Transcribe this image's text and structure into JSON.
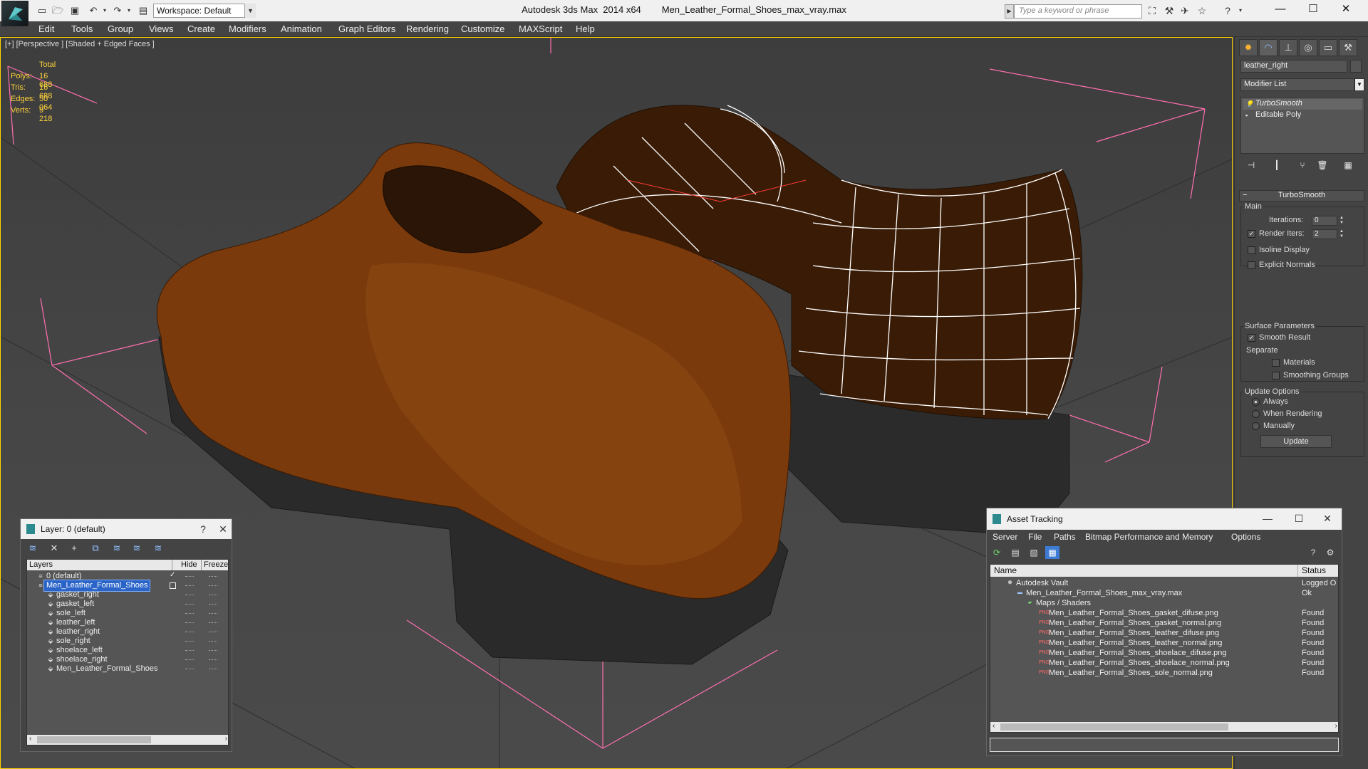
{
  "titlebar": {
    "app_name": "Autodesk 3ds Max  2014 x64",
    "file_name": "Men_Leather_Formal_Shoes_max_vray.max",
    "workspace": "Workspace: Default",
    "search_placeholder": "Type a keyword or phrase",
    "minimize": "—",
    "maximize": "☐",
    "close": "✕"
  },
  "menu": [
    "Edit",
    "Tools",
    "Group",
    "Views",
    "Create",
    "Modifiers",
    "Animation",
    "Graph Editors",
    "Rendering",
    "Customize",
    "MAXScript",
    "Help"
  ],
  "viewport": {
    "label": "[+] [Perspective ] [Shaded + Edged Faces ]",
    "stats": {
      "header": "Total",
      "rows": [
        {
          "name": "Polys:",
          "value": "16 688"
        },
        {
          "name": "Tris:",
          "value": "16 688"
        },
        {
          "name": "Edges:",
          "value": "50 064"
        },
        {
          "name": "Verts:",
          "value": "9 218"
        }
      ]
    }
  },
  "command_panel": {
    "object_name": "leather_right",
    "modifier_list": "Modifier List",
    "stack": [
      "TurboSmooth",
      "Editable Poly"
    ],
    "rollout_title": "TurboSmooth",
    "main_label": "Main",
    "iterations_label": "Iterations:",
    "iterations_value": "0",
    "render_iters_label": "Render Iters:",
    "render_iters_value": "2",
    "render_iters_checked": true,
    "isoline_label": "Isoline Display",
    "explicit_normals_label": "Explicit Normals",
    "surface_params_label": "Surface Parameters",
    "smooth_result_label": "Smooth Result",
    "smooth_result_checked": true,
    "separate_label": "Separate",
    "materials_label": "Materials",
    "smoothing_groups_label": "Smoothing Groups",
    "update_options_label": "Update Options",
    "always_label": "Always",
    "when_rendering_label": "When Rendering",
    "manually_label": "Manually",
    "update_button": "Update"
  },
  "layer_dialog": {
    "title": "Layer: 0 (default)",
    "help": "?",
    "close": "✕",
    "columns": [
      "Layers",
      "Hide",
      "Freeze"
    ],
    "layers": [
      {
        "name": "0 (default)",
        "level": 0,
        "selected": false,
        "current": true
      },
      {
        "name": "Men_Leather_Formal_Shoes",
        "level": 0,
        "selected": true,
        "current": false
      },
      {
        "name": "gasket_right",
        "level": 1,
        "selected": false,
        "current": false
      },
      {
        "name": "gasket_left",
        "level": 1,
        "selected": false,
        "current": false
      },
      {
        "name": "sole_left",
        "level": 1,
        "selected": false,
        "current": false
      },
      {
        "name": "leather_left",
        "level": 1,
        "selected": false,
        "current": false
      },
      {
        "name": "leather_right",
        "level": 1,
        "selected": false,
        "current": false
      },
      {
        "name": "sole_right",
        "level": 1,
        "selected": false,
        "current": false
      },
      {
        "name": "shoelace_left",
        "level": 1,
        "selected": false,
        "current": false
      },
      {
        "name": "shoelace_right",
        "level": 1,
        "selected": false,
        "current": false
      },
      {
        "name": "Men_Leather_Formal_Shoes",
        "level": 1,
        "selected": false,
        "current": false
      }
    ]
  },
  "asset_dialog": {
    "title": "Asset Tracking",
    "menu": [
      "Server",
      "File",
      "Paths",
      "Bitmap Performance and Memory",
      "Options"
    ],
    "columns": [
      "Name",
      "Status"
    ],
    "rows": [
      {
        "name": "Autodesk Vault",
        "status": "Logged O",
        "level": 0,
        "kind": "vault"
      },
      {
        "name": "Men_Leather_Formal_Shoes_max_vray.max",
        "status": "Ok",
        "level": 1,
        "kind": "max"
      },
      {
        "name": "Maps / Shaders",
        "status": "",
        "level": 2,
        "kind": "folder"
      },
      {
        "name": "Men_Leather_Formal_Shoes_gasket_difuse.png",
        "status": "Found",
        "level": 3,
        "kind": "png"
      },
      {
        "name": "Men_Leather_Formal_Shoes_gasket_normal.png",
        "status": "Found",
        "level": 3,
        "kind": "png"
      },
      {
        "name": "Men_Leather_Formal_Shoes_leather_difuse.png",
        "status": "Found",
        "level": 3,
        "kind": "png"
      },
      {
        "name": "Men_Leather_Formal_Shoes_leather_normal.png",
        "status": "Found",
        "level": 3,
        "kind": "png"
      },
      {
        "name": "Men_Leather_Formal_Shoes_shoelace_difuse.png",
        "status": "Found",
        "level": 3,
        "kind": "png"
      },
      {
        "name": "Men_Leather_Formal_Shoes_shoelace_normal.png",
        "status": "Found",
        "level": 3,
        "kind": "png"
      },
      {
        "name": "Men_Leather_Formal_Shoes_sole_normal.png",
        "status": "Found",
        "level": 3,
        "kind": "png"
      }
    ]
  },
  "colors": {
    "viewport_border": "#ffd400",
    "stats_text": "#ffd23a",
    "selection": "#2a64c8",
    "leather": "#7a3a0c",
    "sole": "#2a2a2a",
    "gizmo": "#ff6fb0"
  }
}
